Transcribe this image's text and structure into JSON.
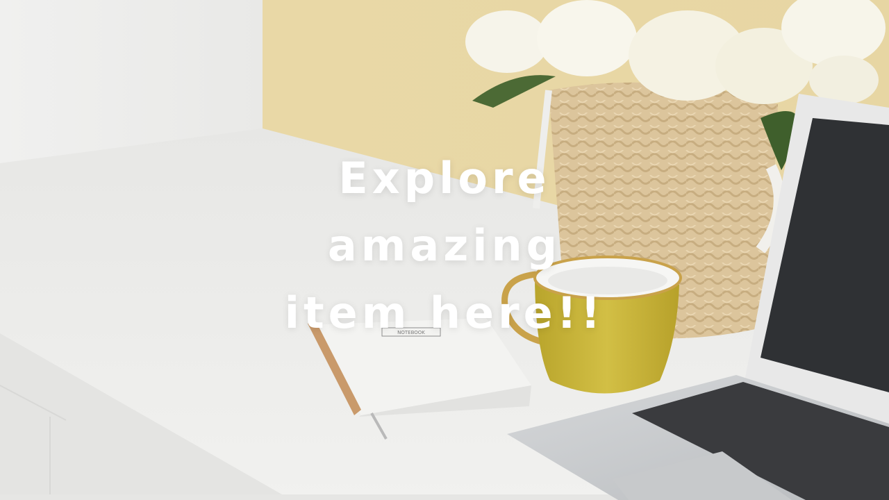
{
  "hero": {
    "headline_lines": [
      "Explore",
      "amazing",
      "item here!!"
    ],
    "notebook_label": "NOTEBOOK"
  },
  "palette": {
    "wall": "#e4d5a6",
    "desk": "#efefed",
    "mug": "#cdb93c",
    "mug_rim": "#c9a24a",
    "basket": "#dcc49a",
    "laptop_body": "#cfd1d3",
    "laptop_screen": "#2f3134",
    "headline_text": "#ffffff"
  },
  "icons": [
    "flower-icon"
  ]
}
